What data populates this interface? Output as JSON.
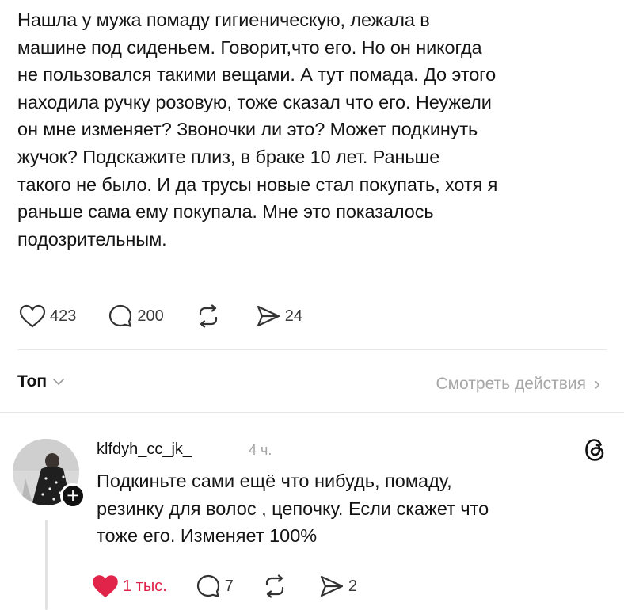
{
  "post": {
    "text_lines": [
      "Нашла у мужа помаду гигиеническую, лежала в",
      "машине под сиденьем. Говорит,что его. Но он никогда",
      "не пользовался такими вещами. А тут помада. До этого",
      "находила ручку розовую, тоже сказал что его. Неужели",
      "он мне изменяет? Звоночки ли это? Может подкинуть",
      "жучок? Подскажите плиз, в браке 10 лет. Раньше",
      "такого не было. И да трусы новые стал покупать, хотя я",
      "раньше сама ему покупала. Мне это показалось",
      "подозрительным."
    ],
    "actions": {
      "likes": "423",
      "comments": "200",
      "shares": "24"
    }
  },
  "replies_header": {
    "sort_label": "Топ",
    "view_activity_label": "Смотреть действия",
    "view_activity_chevron": "›"
  },
  "reply": {
    "username": "klfdyh_cc_jk_",
    "time": "4 ч.",
    "follow_badge": "+",
    "text_lines": [
      "Подкиньте сами ещё что нибудь, помаду,",
      "резинку для волос , цепочку.  Если скажет что",
      "тоже его. Изменяет 100%"
    ],
    "actions": {
      "likes": "1 тыс.",
      "comments": "7",
      "shares": "2"
    }
  },
  "colors": {
    "text": "#141414",
    "muted": "#a7a7a7",
    "like_active": "#e0244a",
    "divider": "#e6e6e6"
  },
  "icons": {
    "like": "heart-icon",
    "comment": "comment-bubble-icon",
    "repost": "repost-icon",
    "share": "send-icon",
    "sort": "chevron-down-icon",
    "app": "threads-logo-icon"
  }
}
